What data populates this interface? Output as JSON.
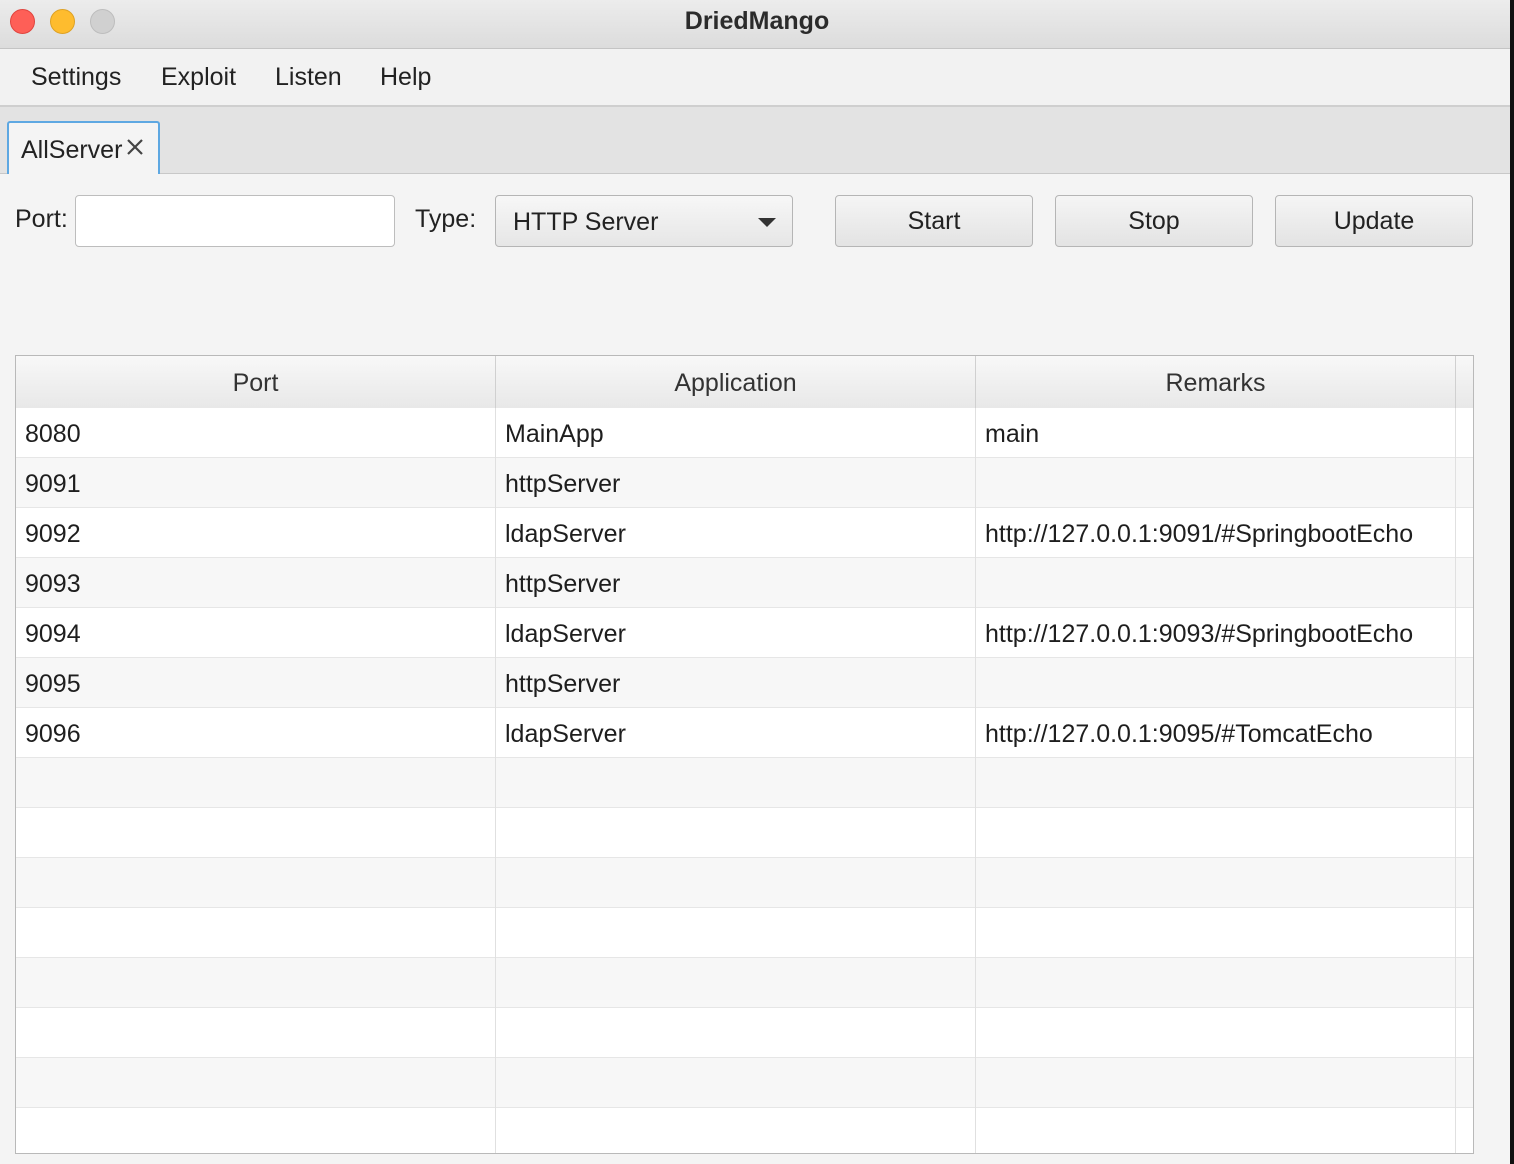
{
  "window": {
    "title": "DriedMango"
  },
  "menubar": {
    "items": [
      {
        "label": "Settings"
      },
      {
        "label": "Exploit"
      },
      {
        "label": "Listen"
      },
      {
        "label": "Help"
      }
    ]
  },
  "tabs": [
    {
      "label": "AllServer",
      "closable": true,
      "active": true
    }
  ],
  "form": {
    "port_label": "Port:",
    "port_value": "",
    "type_label": "Type:",
    "type_selected": "HTTP Server",
    "buttons": {
      "start": "Start",
      "stop": "Stop",
      "update": "Update"
    }
  },
  "table": {
    "columns": [
      "Port",
      "Application",
      "Remarks"
    ],
    "rows": [
      {
        "port": "8080",
        "application": "MainApp",
        "remarks": "main"
      },
      {
        "port": "9091",
        "application": "httpServer",
        "remarks": ""
      },
      {
        "port": "9092",
        "application": "ldapServer",
        "remarks": "http://127.0.0.1:9091/#SpringbootEcho"
      },
      {
        "port": "9093",
        "application": "httpServer",
        "remarks": ""
      },
      {
        "port": "9094",
        "application": "ldapServer",
        "remarks": "http://127.0.0.1:9093/#SpringbootEcho"
      },
      {
        "port": "9095",
        "application": "httpServer",
        "remarks": ""
      },
      {
        "port": "9096",
        "application": "ldapServer",
        "remarks": "http://127.0.0.1:9095/#TomcatEcho"
      }
    ]
  },
  "icons": {
    "close_traffic": "close-window-icon",
    "minimize_traffic": "minimize-window-icon",
    "zoom_traffic": "zoom-window-icon",
    "tab_close": "close-icon",
    "dropdown": "chevron-down-icon"
  }
}
